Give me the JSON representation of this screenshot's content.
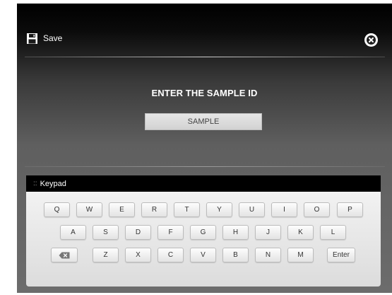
{
  "header": {
    "save_label": "Save",
    "save_icon": "floppy-disk-icon",
    "close_icon": "close-icon"
  },
  "prompt": {
    "title": "ENTER THE SAMPLE ID",
    "sample_value": "SAMPLE"
  },
  "keypad": {
    "title": "Keypad",
    "rows": [
      [
        "Q",
        "W",
        "E",
        "R",
        "T",
        "Y",
        "U",
        "I",
        "O",
        "P"
      ],
      [
        "A",
        "S",
        "D",
        "F",
        "G",
        "H",
        "J",
        "K",
        "L"
      ],
      [
        "Z",
        "X",
        "C",
        "V",
        "B",
        "N",
        "M"
      ]
    ],
    "backspace_icon": "backspace-icon",
    "enter_label": "Enter"
  },
  "colors": {
    "header_bg": "#000000",
    "panel_bottom": "#6c6c6c",
    "keypad_bg": "#e8e8e8",
    "key_text": "#333333"
  }
}
